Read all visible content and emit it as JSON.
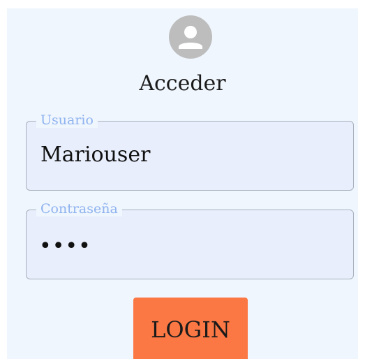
{
  "form": {
    "title": "Acceder",
    "username": {
      "label": "Usuario",
      "value": "Mariouser"
    },
    "password": {
      "label": "Contraseña",
      "value": "••••"
    },
    "login_label": "LOGIN"
  },
  "colors": {
    "card_background": "#eff6fe",
    "field_background": "#e8eefc",
    "label_color": "#8fb3ef",
    "button_background": "#fb7845",
    "avatar_background": "#bdbdbd"
  },
  "icons": {
    "avatar": "account-circle-icon"
  }
}
